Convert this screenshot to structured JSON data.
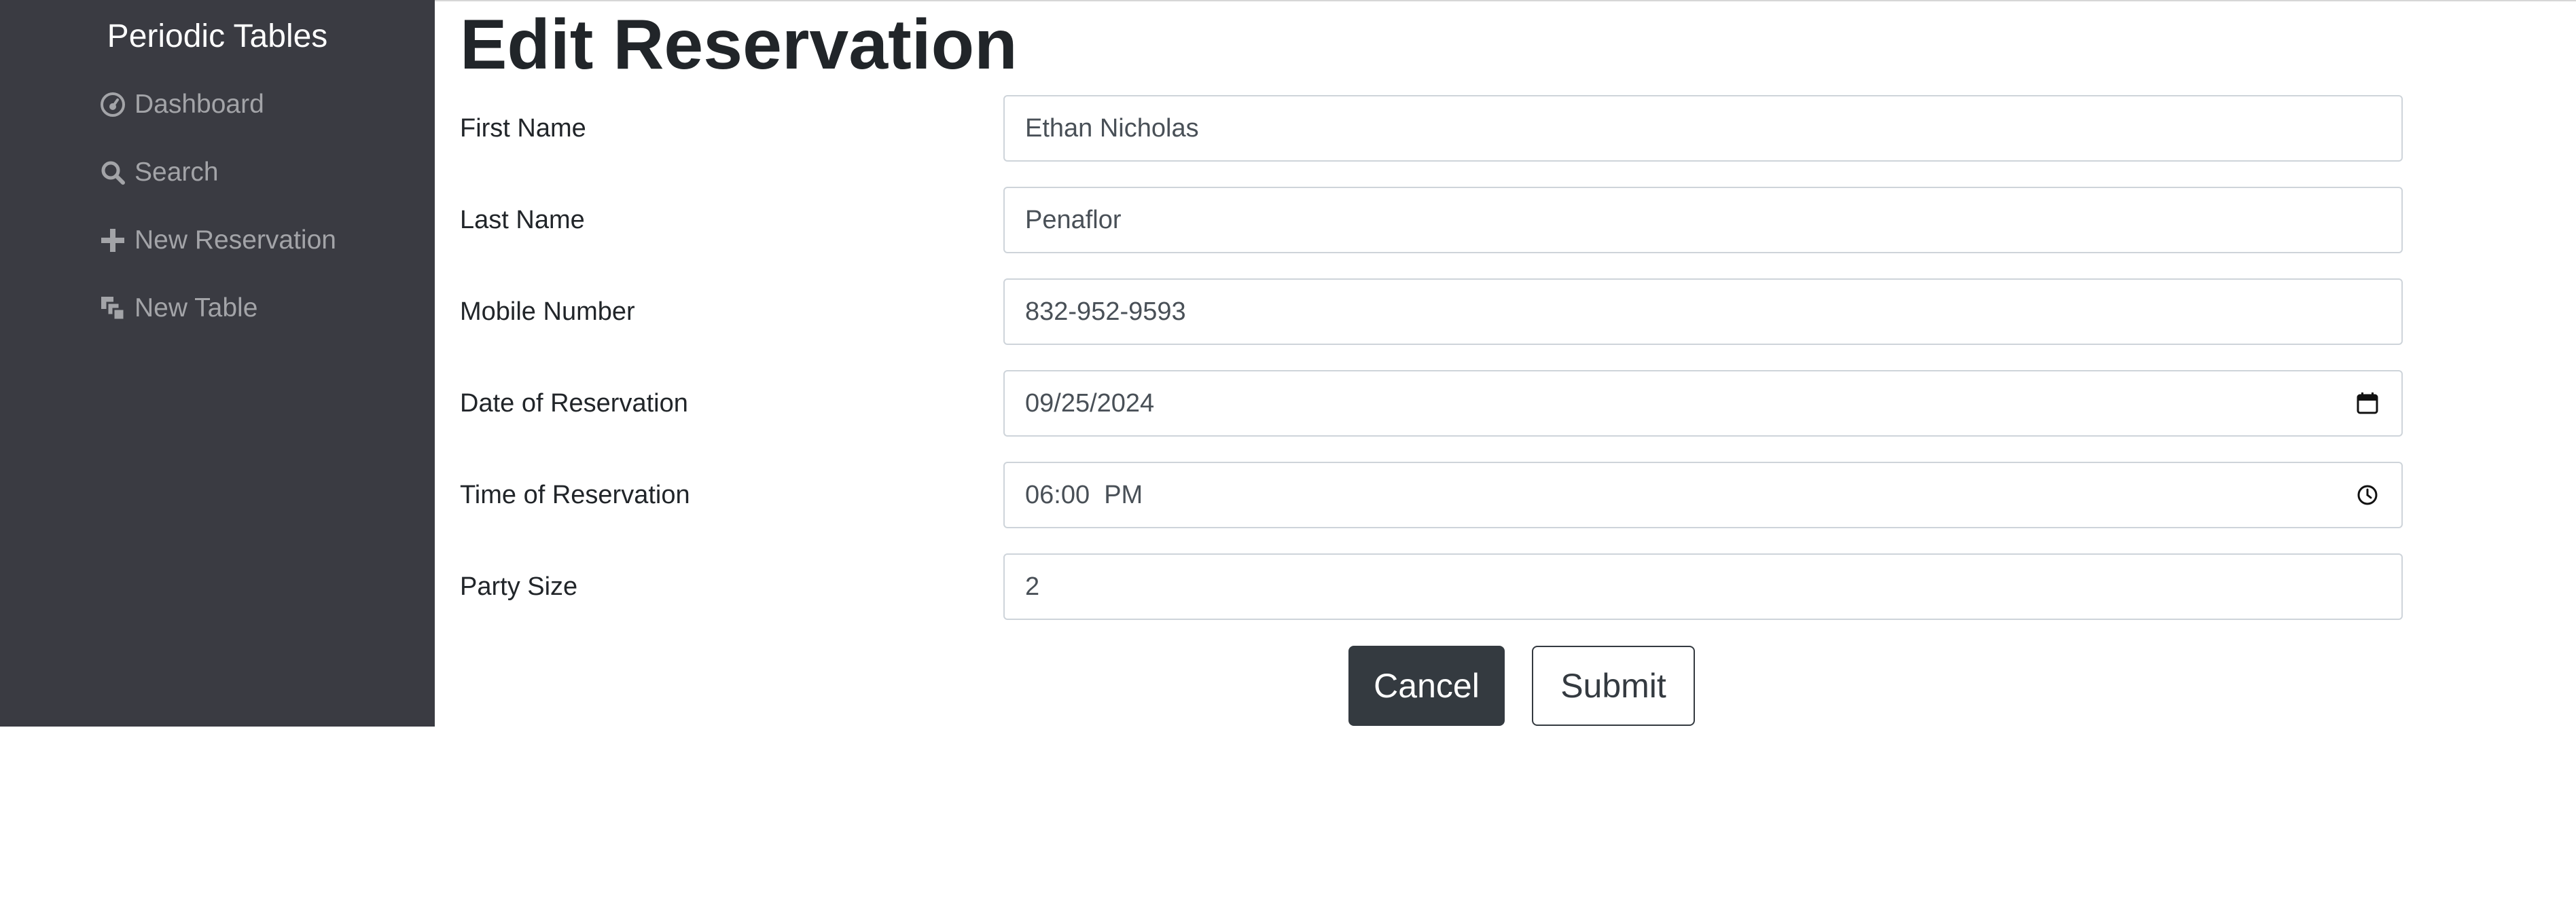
{
  "sidebar": {
    "brand": "Periodic Tables",
    "items": [
      {
        "label": "Dashboard",
        "icon": "dashboard-icon"
      },
      {
        "label": "Search",
        "icon": "search-icon"
      },
      {
        "label": "New Reservation",
        "icon": "plus-icon"
      },
      {
        "label": "New Table",
        "icon": "layers-icon"
      }
    ]
  },
  "main": {
    "title": "Edit Reservation",
    "fields": [
      {
        "label": "First Name",
        "value": "Ethan Nicholas"
      },
      {
        "label": "Last Name",
        "value": "Penaflor"
      },
      {
        "label": "Mobile Number",
        "value": "832-952-9593"
      },
      {
        "label": "Date of Reservation",
        "value": "09/25/2024",
        "icon": "calendar-icon"
      },
      {
        "label": "Time of Reservation",
        "value": "06:00  PM",
        "icon": "clock-icon"
      },
      {
        "label": "Party Size",
        "value": "2"
      }
    ],
    "buttons": {
      "cancel": "Cancel",
      "submit": "Submit"
    }
  },
  "colors": {
    "sidebar_bg": "#3a3b42",
    "sidebar_text": "#a3a4a8",
    "brand_text": "#ffffff",
    "button_dark": "#343a40",
    "input_border": "#ced4da"
  }
}
